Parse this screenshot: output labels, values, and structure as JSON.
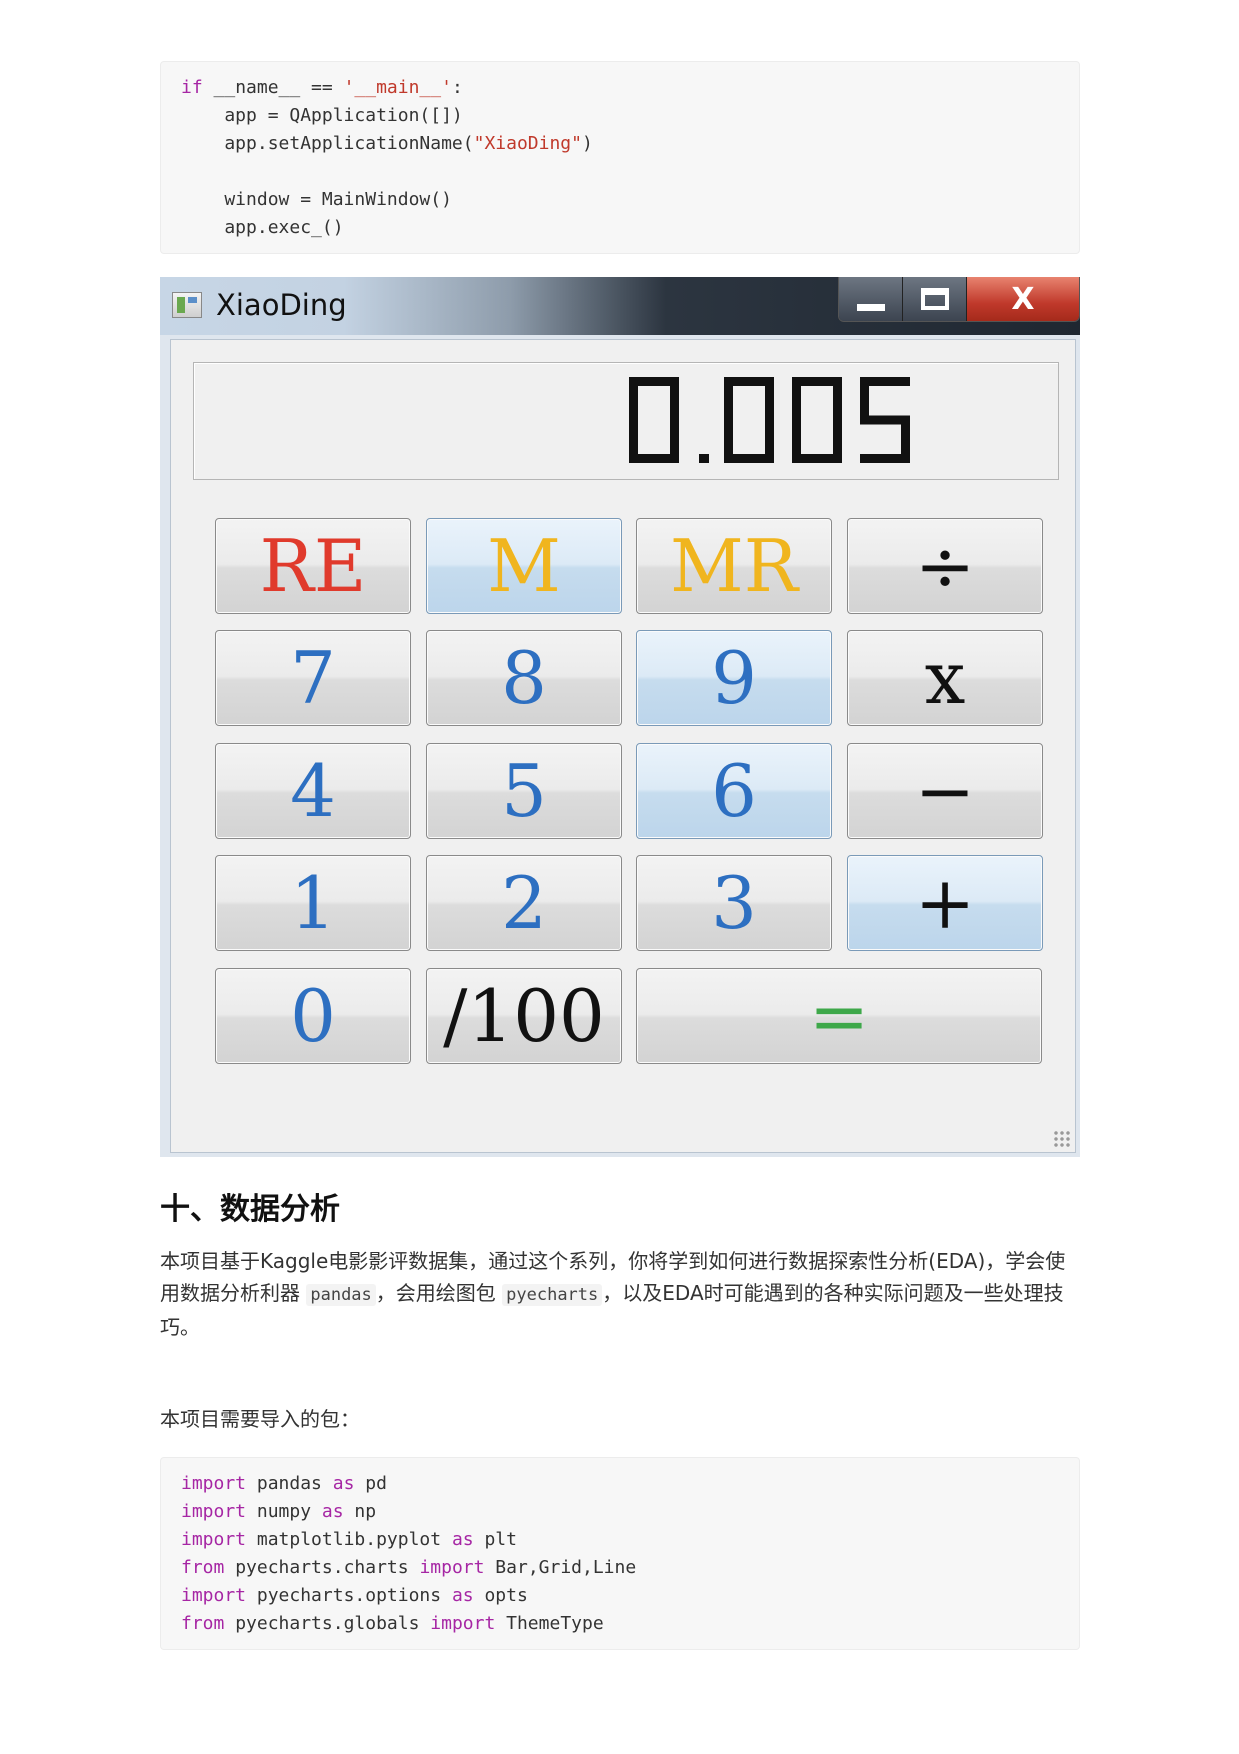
{
  "code_block_1": {
    "lines": [
      {
        "parts": [
          {
            "t": "if",
            "k": "kw"
          },
          {
            "t": " __name__ == "
          },
          {
            "t": "'__main__'",
            "k": "str"
          },
          {
            "t": ":"
          }
        ]
      },
      {
        "parts": [
          {
            "t": "    app = QApplication([])"
          }
        ]
      },
      {
        "parts": [
          {
            "t": "    app.setApplicationName("
          },
          {
            "t": "\"XiaoDing\"",
            "k": "str"
          },
          {
            "t": ")"
          }
        ]
      },
      {
        "parts": [
          {
            "t": ""
          }
        ]
      },
      {
        "parts": [
          {
            "t": "    window = MainWindow()"
          }
        ]
      },
      {
        "parts": [
          {
            "t": "    app.exec_()"
          }
        ]
      }
    ]
  },
  "calculator": {
    "window_title": "XiaoDing",
    "close_glyph": "X",
    "display_value": "0.005",
    "buttons": {
      "re": "RE",
      "m": "M",
      "mr": "MR",
      "divide": "÷",
      "seven": "7",
      "eight": "8",
      "nine": "9",
      "multiply": "x",
      "four": "4",
      "five": "5",
      "six": "6",
      "minus": "−",
      "one": "1",
      "two": "2",
      "three": "3",
      "plus": "+",
      "zero": "0",
      "percent": "/100",
      "equals": "="
    },
    "colors": {
      "digit": "#2d6fc1",
      "re": "#e03a2c",
      "memory": "#f0b51e",
      "operator": "#111111",
      "equals": "#3ea84a",
      "close_button": "#c0392b"
    }
  },
  "section": {
    "heading": "十、数据分析",
    "para1_a": "本项目基于Kaggle电影影评数据集，通过这个系列，你将学到如何进行数据探索性分析(EDA)，学会使用数据分析利器",
    "code_pandas": "pandas",
    "para1_b": "，会用绘图包",
    "code_pyecharts": "pyecharts",
    "para1_c": "，以及EDA时可能遇到的各种实际问题及一些处理技巧。",
    "para2": "本项目需要导入的包："
  },
  "code_block_2": {
    "lines": [
      {
        "parts": [
          {
            "t": "import",
            "k": "kw"
          },
          {
            "t": " pandas "
          },
          {
            "t": "as",
            "k": "kw"
          },
          {
            "t": " pd"
          }
        ]
      },
      {
        "parts": [
          {
            "t": "import",
            "k": "kw"
          },
          {
            "t": " numpy "
          },
          {
            "t": "as",
            "k": "kw"
          },
          {
            "t": " np"
          }
        ]
      },
      {
        "parts": [
          {
            "t": "import",
            "k": "kw"
          },
          {
            "t": " matplotlib.pyplot "
          },
          {
            "t": "as",
            "k": "kw"
          },
          {
            "t": " plt"
          }
        ]
      },
      {
        "parts": [
          {
            "t": "from",
            "k": "kw"
          },
          {
            "t": " pyecharts.charts "
          },
          {
            "t": "import",
            "k": "kw"
          },
          {
            "t": " Bar,Grid,Line"
          }
        ]
      },
      {
        "parts": [
          {
            "t": "import",
            "k": "kw"
          },
          {
            "t": " pyecharts.options "
          },
          {
            "t": "as",
            "k": "kw"
          },
          {
            "t": " opts"
          }
        ]
      },
      {
        "parts": [
          {
            "t": "from",
            "k": "kw"
          },
          {
            "t": " pyecharts.globals "
          },
          {
            "t": "import",
            "k": "kw"
          },
          {
            "t": " ThemeType"
          }
        ]
      }
    ]
  }
}
